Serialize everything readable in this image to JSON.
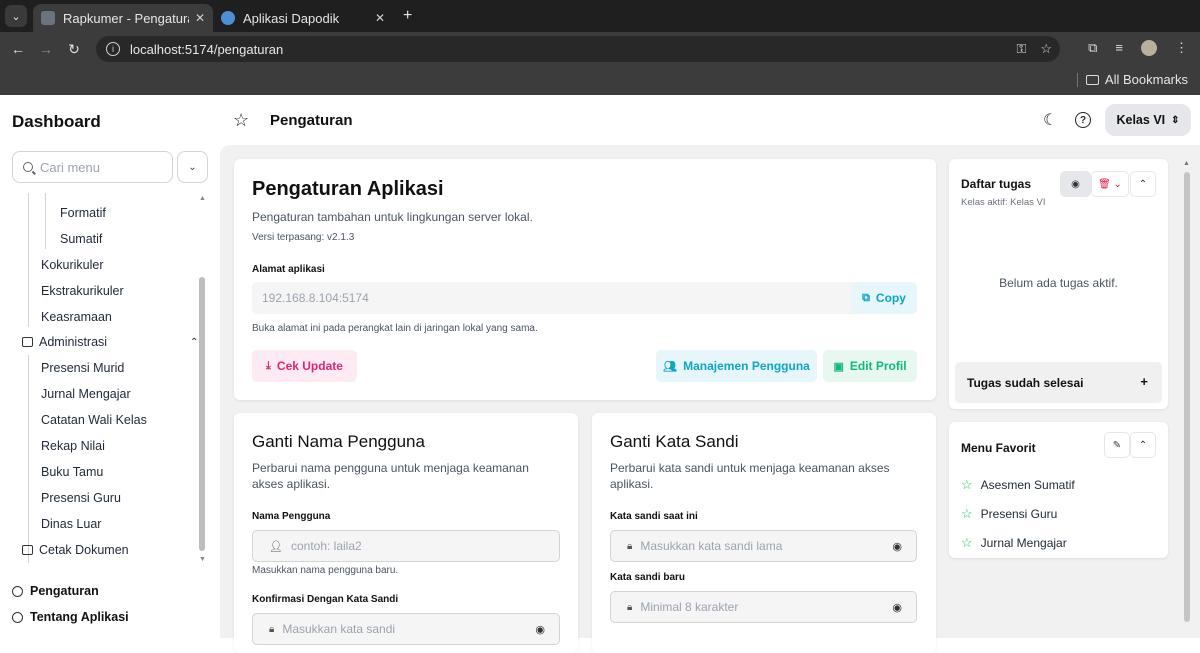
{
  "browser": {
    "tabs": [
      {
        "title": "Rapkumer - Pengaturan",
        "active": true
      },
      {
        "title": "Aplikasi Dapodik",
        "active": false
      }
    ],
    "url": "localhost:5174/pengaturan",
    "bookmarks_label": "All Bookmarks"
  },
  "sidebar": {
    "title": "Dashboard",
    "search_placeholder": "Cari menu",
    "items": {
      "formatif": "Formatif",
      "sumatif": "Sumatif",
      "kokurikuler": "Kokurikuler",
      "ekstrakurikuler": "Ekstrakurikuler",
      "keasramaan": "Keasramaan",
      "administrasi": "Administrasi",
      "presensi_murid": "Presensi Murid",
      "jurnal_mengajar": "Jurnal Mengajar",
      "catatan_wali_kelas": "Catatan Wali Kelas",
      "rekap_nilai": "Rekap Nilai",
      "buku_tamu": "Buku Tamu",
      "presensi_guru": "Presensi Guru",
      "dinas_luar": "Dinas Luar",
      "cetak_dokumen": "Cetak Dokumen"
    },
    "bottom": {
      "pengaturan": "Pengaturan",
      "tentang": "Tentang Aplikasi"
    }
  },
  "header": {
    "title": "Pengaturan",
    "kelas": "Kelas VI"
  },
  "app_settings": {
    "title": "Pengaturan Aplikasi",
    "description": "Pengaturan tambahan untuk lingkungan server lokal.",
    "version": "Versi terpasang: v2.1.3",
    "address_label": "Alamat aplikasi",
    "address_value": "192.168.8.104:5174",
    "copy_label": "Copy",
    "address_hint": "Buka alamat ini pada perangkat lain di jaringan lokal yang sama.",
    "cek_update": "Cek Update",
    "manajemen_pengguna": "Manajemen Pengguna",
    "edit_profil": "Edit Profil"
  },
  "ganti_nama": {
    "title": "Ganti Nama Pengguna",
    "description": "Perbarui nama pengguna untuk menjaga keamanan akses aplikasi.",
    "username_label": "Nama Pengguna",
    "username_placeholder": "contoh: laila2",
    "username_hint": "Masukkan nama pengguna baru.",
    "confirm_label": "Konfirmasi Dengan Kata Sandi",
    "confirm_placeholder": "Masukkan kata sandi"
  },
  "ganti_sandi": {
    "title": "Ganti Kata Sandi",
    "description": "Perbarui kata sandi untuk menjaga keamanan akses aplikasi.",
    "current_label": "Kata sandi saat ini",
    "current_placeholder": "Masukkan kata sandi lama",
    "new_label": "Kata sandi baru",
    "new_placeholder": "Minimal 8 karakter"
  },
  "daftar_tugas": {
    "title": "Daftar tugas",
    "subtitle": "Kelas aktif: Kelas VI",
    "empty": "Belum ada tugas aktif.",
    "done_label": "Tugas sudah selesai",
    "done_plus": "+"
  },
  "menu_favorit": {
    "title": "Menu Favorit",
    "items": [
      "Asesmen Sumatif",
      "Presensi Guru",
      "Jurnal Mengajar"
    ]
  },
  "colors": {
    "accent_cyan": "#0ea5c6",
    "accent_pink": "#db2777",
    "accent_green": "#10b981",
    "star_green": "#22c55e"
  }
}
